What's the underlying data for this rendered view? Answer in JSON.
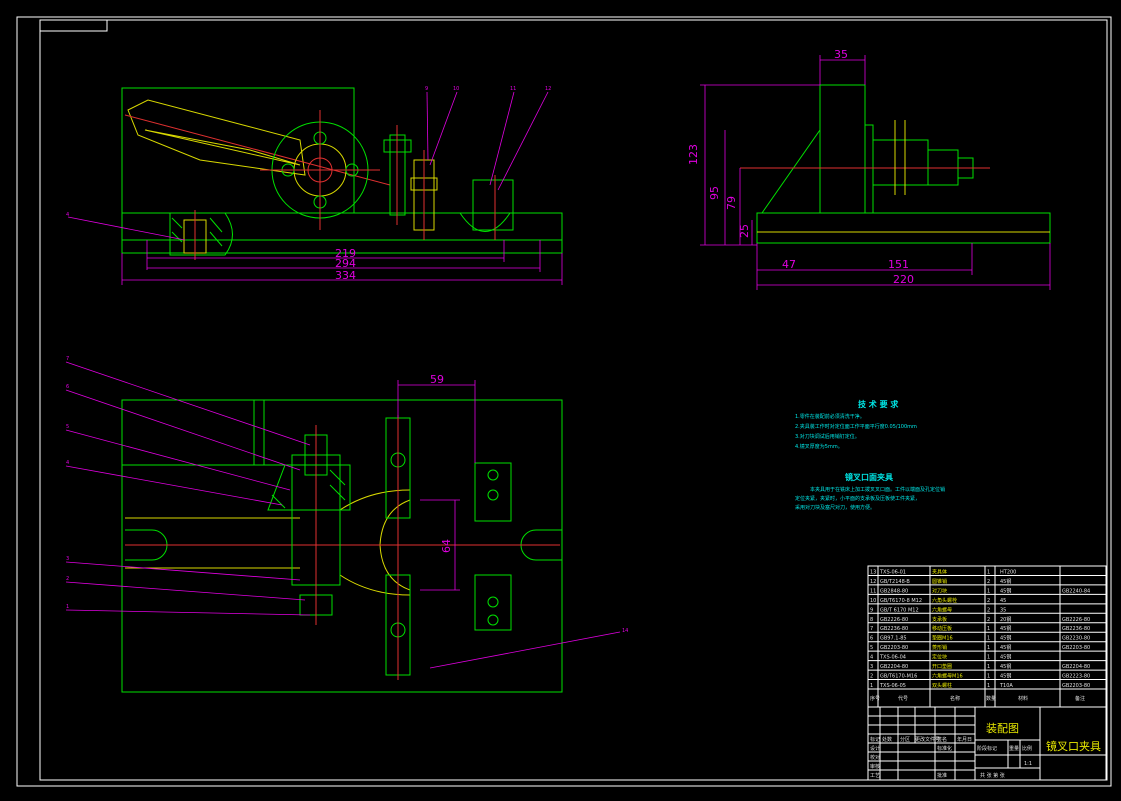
{
  "dimensions": {
    "front": [
      "219",
      "294",
      "334"
    ],
    "side": [
      "35",
      "123",
      "95",
      "79",
      "25",
      "47",
      "151",
      "220"
    ],
    "plan": [
      "59",
      "64"
    ]
  },
  "part_labels": {
    "front": [
      "4",
      "9",
      "10",
      "11",
      "12"
    ],
    "plan": [
      "7",
      "6",
      "5",
      "4",
      "3",
      "2",
      "1",
      "14"
    ]
  },
  "notes": {
    "tech_title": "技 术 要 求",
    "tech_items": [
      "1.零件在装配前必须清洗干净。",
      "2.夹具装工作时对定位面工作平面平行度0.05/100mm",
      "3.对刀块调试后用销钉定位。",
      "4.镜叉厚度为5mm。"
    ],
    "desc_title": "镜叉口面夹具",
    "desc_lines": [
      "本夹具用于在铣床上加工拨叉叉口面。工件以端面及孔定位销",
      "定位夹紧，夹紧时，小平面的支承板及压板使工件夹紧，",
      "采用对刀块及塞尺对刀，使用方便。"
    ]
  },
  "bom": {
    "rows": [
      {
        "no": "13",
        "code": "TXS-06-01",
        "name": "夹具体",
        "qty": "1",
        "mat": "HT200",
        "remark": ""
      },
      {
        "no": "12",
        "code": "GB/T2148-B",
        "name": "圆锥销",
        "qty": "2",
        "mat": "45钢",
        "remark": ""
      },
      {
        "no": "11",
        "code": "GB2848-80",
        "name": "对刀块",
        "qty": "1",
        "mat": "45钢",
        "remark": "GB2240-84"
      },
      {
        "no": "10",
        "code": "GB/T6170-8 M12",
        "name": "六角头螺栓",
        "qty": "2",
        "mat": "45",
        "remark": ""
      },
      {
        "no": "9",
        "code": "GB/T 6170 M12",
        "name": "六角螺母",
        "qty": "2",
        "mat": "35",
        "remark": ""
      },
      {
        "no": "8",
        "code": "GB2226-80",
        "name": "支承板",
        "qty": "2",
        "mat": "20钢",
        "remark": "GB2226-80"
      },
      {
        "no": "7",
        "code": "GB2236-80",
        "name": "移动压板",
        "qty": "1",
        "mat": "45钢",
        "remark": "GB2236-80"
      },
      {
        "no": "6",
        "code": "GB97.1-85",
        "name": "垫圈M16",
        "qty": "1",
        "mat": "45钢",
        "remark": "GB2230-80"
      },
      {
        "no": "5",
        "code": "GB2203-80",
        "name": "菱形销",
        "qty": "1",
        "mat": "45钢",
        "remark": "GB2203-80"
      },
      {
        "no": "4",
        "code": "TXS-06-04",
        "name": "定位块",
        "qty": "1",
        "mat": "45钢",
        "remark": ""
      },
      {
        "no": "3",
        "code": "GB2204-80",
        "name": "开口垫圈",
        "qty": "1",
        "mat": "45钢",
        "remark": "GB2204-80"
      },
      {
        "no": "2",
        "code": "GB/T6170-M16",
        "name": "六角螺母M16",
        "qty": "1",
        "mat": "45钢",
        "remark": "GB2223-80"
      },
      {
        "no": "1",
        "code": "TXS-06-05",
        "name": "双头螺柱",
        "qty": "1",
        "mat": "T10A",
        "remark": "GB2203-80"
      }
    ],
    "headers": [
      "序号",
      "代号",
      "名称",
      "数量",
      "材料",
      "备注"
    ]
  },
  "title_block": {
    "drawing_type": "装配图",
    "title": "镜叉口夹具",
    "scale": "1:1",
    "rows_left": [
      "标记",
      "设计",
      "校对",
      "审核",
      "工艺"
    ],
    "cols_left": [
      "处数",
      "分区",
      "更改文件号",
      "签名",
      "年月日"
    ],
    "std": "标准化",
    "approve": "批准",
    "stage": "阶段标记",
    "weight": "重量",
    "ratio": "比例",
    "sheet": "共  张  第  张"
  },
  "colors": {
    "background": "#000000",
    "outline": "#00e000",
    "dimension": "#e000e0",
    "hidden": "#d8d800",
    "center": "#e03030",
    "text": "#00e8e8"
  }
}
